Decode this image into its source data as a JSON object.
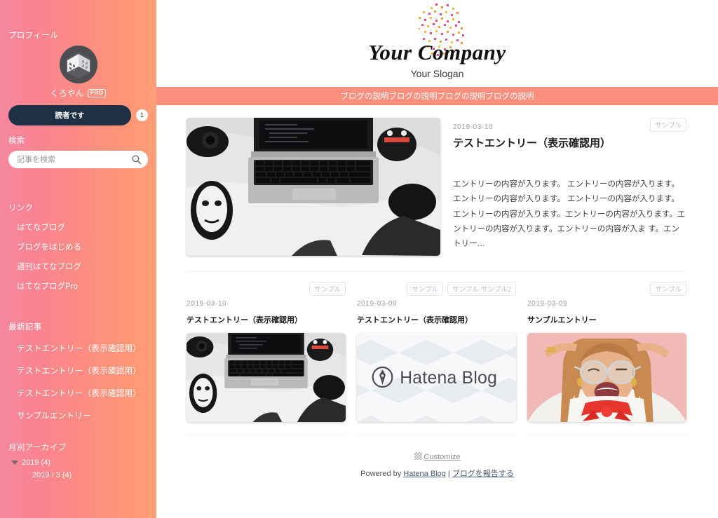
{
  "sidebar": {
    "profile": {
      "heading": "プロフィール",
      "username": "くろやん",
      "pro_badge": "PRO",
      "subscribe_label": "読者です",
      "subscriber_count": "1",
      "avatar_icon": "isometric-building-avatar"
    },
    "search": {
      "heading": "検索",
      "placeholder": "記事を検索",
      "value": "",
      "icon": "search-icon"
    },
    "links": {
      "heading": "リンク",
      "items": [
        {
          "label": "はてなブログ"
        },
        {
          "label": "ブログをはじめる"
        },
        {
          "label": "週刊はてなブログ"
        },
        {
          "label": "はてなブログPro"
        }
      ]
    },
    "latest": {
      "heading": "最新記事",
      "items": [
        {
          "label": "テストエントリー（表示確認用）"
        },
        {
          "label": "テストエントリー（表示確認用）"
        },
        {
          "label": "テストエントリー（表示確認用）"
        },
        {
          "label": "サンプルエントリー"
        }
      ]
    },
    "archive": {
      "heading": "月別アーカイブ",
      "year_label": "2019 (4)",
      "month_label": "2019 / 3 (4)",
      "toggle_icon": "triangle-down-icon"
    }
  },
  "header": {
    "title": "Your Company",
    "slogan": "Your Slogan",
    "logo_icon": "pixel-face-logo",
    "description": "ブログの説明ブログの説明ブログの説明ブログの説明"
  },
  "featured": {
    "date": "2019-03-10",
    "title": "テストエントリー（表示確認用）",
    "tags": [
      "サンプル"
    ],
    "excerpt": "エントリーの内容が入ります。 エントリーの内容が入ります。 エントリーの内容が入ります。 エントリーの内容が入ります。 エントリーの内容が入ります。エントリーの内容が入ります。エントリーの内容が入ります。エントリーの内容が入ま す。エントリー…",
    "thumb_icon": "laptop-mask-photo"
  },
  "cards": [
    {
      "date": "2019-03-10",
      "title": "テストエントリー（表示確認用）",
      "tags": [
        "サンプル"
      ],
      "thumb_icon": "laptop-mask-photo"
    },
    {
      "date": "2019-03-09",
      "title": "テストエントリー（表示確認用）",
      "tags": [
        "サンプル",
        "サンプル-サンプル2"
      ],
      "thumb_icon": "hatena-blog-placeholder"
    },
    {
      "date": "2019-03-09",
      "title": "サンプルエントリー",
      "tags": [
        "サンプル"
      ],
      "thumb_icon": "laughing-woman-photo"
    }
  ],
  "footer": {
    "customize_label": "Customize",
    "customize_icon": "checkerboard-icon",
    "powered_prefix": "Powered by ",
    "powered_link": "Hatena Blog",
    "separator": " | ",
    "report_link": "ブログを報告する"
  },
  "colors": {
    "sidebar_start": "#f5879f",
    "sidebar_end": "#ff9f77",
    "desc_bar": "#fa8f7d",
    "subscribe_button": "#1e3046",
    "tag_text": "#b9c0c9"
  }
}
